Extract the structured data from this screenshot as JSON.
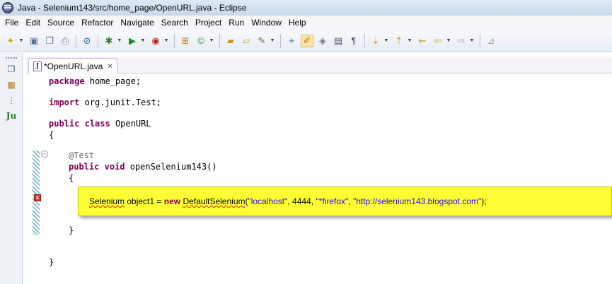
{
  "window": {
    "title": "Java - Selenium143/src/home_page/OpenURL.java - Eclipse"
  },
  "menu": {
    "items": [
      {
        "label": "File"
      },
      {
        "label": "Edit"
      },
      {
        "label": "Source"
      },
      {
        "label": "Refactor"
      },
      {
        "label": "Navigate"
      },
      {
        "label": "Search"
      },
      {
        "label": "Project"
      },
      {
        "label": "Run"
      },
      {
        "label": "Window"
      },
      {
        "label": "Help"
      }
    ]
  },
  "toolbar": {
    "icons": [
      "new-icon",
      "save-icon",
      "save-all-icon",
      "print-icon",
      "skip-breakpoints-icon",
      "debug-icon",
      "run-icon",
      "external-tools-icon",
      "new-java-package-icon",
      "new-java-class-icon",
      "open-type-icon",
      "open-task-icon",
      "search-icon",
      "next-annotation-icon",
      "toggle-mark-occurrences-icon",
      "toggle-block-selection-icon",
      "show-whitespace-icon",
      "show-source-icon",
      "next-annotation-down-icon",
      "previous-annotation-icon",
      "last-edit-icon",
      "back-icon",
      "forward-icon",
      "pin-icon"
    ]
  },
  "side_trim": {
    "icons": [
      "restore-icon",
      "package-explorer-icon",
      "hierarchy-icon",
      "junit-icon"
    ],
    "junit_label": "Ju"
  },
  "editor": {
    "tab": {
      "label": "*OpenURL.java",
      "close": "✕"
    },
    "lines": {
      "package_kw": "package",
      "package_rest": " home_page;",
      "import_kw": "import",
      "import_rest": " org.junit.Test;",
      "class_kw1": "public",
      "class_kw2": "class",
      "class_name": " OpenURL",
      "open_brace": "{",
      "annotation": "@Test",
      "method_kw1": "public",
      "method_kw2": "void",
      "method_name": " openSelenium143()",
      "method_open": "{",
      "method_close": "}",
      "class_close": "}"
    },
    "highlight": {
      "type_name": "Selenium",
      "middle": " object1 = ",
      "new_kw": "new",
      "ctor": "DefaultSelenium",
      "open_paren": "(",
      "arg1": "\"localhost\"",
      "sep1": ", 4444, ",
      "arg3": "\"*firefox\"",
      "sep2": ", ",
      "arg4": "\"http://selenium143.blogspot.com\"",
      "close": ");"
    },
    "error_marker": "x",
    "fold_symbol": "−"
  },
  "colors": {
    "keyword": "#7f0055",
    "string": "#2a00ff",
    "annotation": "#646464",
    "highlight": "#ffff33"
  }
}
